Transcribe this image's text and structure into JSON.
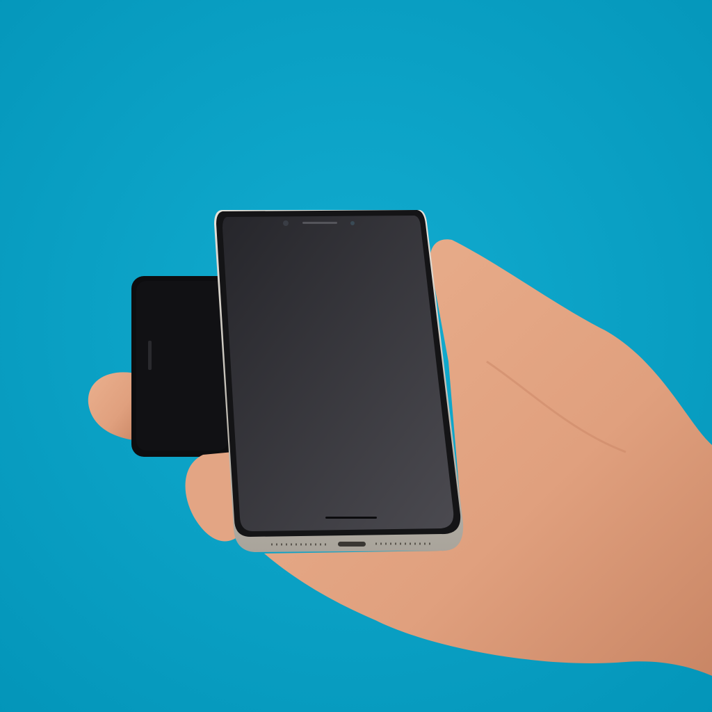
{
  "scene": {
    "subject": "hand-holding-two-smartphones",
    "colors": {
      "background": "#0aa3c7",
      "skin": "#e0a07e",
      "skin_shadow": "#c98665",
      "screen_dark": "#2b2b30",
      "screen_light": "#4a494f",
      "frame_silver": "#cfcac1",
      "back_phone": "#0d0d0f"
    }
  }
}
